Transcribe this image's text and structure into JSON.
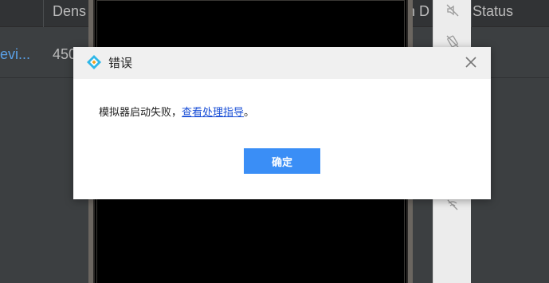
{
  "table": {
    "columns": {
      "density": "Dens",
      "hidden_partial": "n D",
      "status": "Status"
    },
    "row": {
      "device_name": "evi...",
      "density_value": "450"
    }
  },
  "toolbar": {
    "icons": [
      "mute-icon",
      "rotate-icon",
      "signal-off-icon"
    ]
  },
  "dialog": {
    "title": "错误",
    "message_prefix": "模拟器启动失败，",
    "help_link": "查看处理指导",
    "message_suffix": "。",
    "ok_label": "确定"
  },
  "colors": {
    "accent": "#3a8ef6",
    "link": "#1a4fd6",
    "background": "#3c3f41"
  }
}
